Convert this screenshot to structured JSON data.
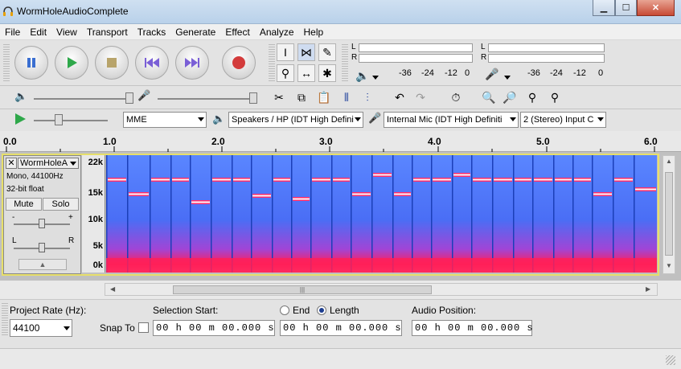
{
  "window": {
    "title": "WormHoleAudioComplete"
  },
  "menu": [
    "File",
    "Edit",
    "View",
    "Transport",
    "Tracks",
    "Generate",
    "Effect",
    "Analyze",
    "Help"
  ],
  "meters": {
    "left": "L",
    "right": "R",
    "ticks": [
      "-36",
      "-24",
      "-12",
      "0"
    ]
  },
  "device": {
    "host": "MME",
    "output": "Speakers / HP (IDT High Defini",
    "input": "Internal Mic (IDT High Definiti",
    "channels": "2 (Stereo) Input C"
  },
  "ruler": [
    "0.0",
    "1.0",
    "2.0",
    "3.0",
    "4.0",
    "5.0",
    "6.0"
  ],
  "track": {
    "name": "WormHoleA",
    "info1": "Mono, 44100Hz",
    "info2": "32-bit float",
    "mute": "Mute",
    "solo": "Solo",
    "gain_minus": "-",
    "gain_plus": "+",
    "pan_left": "L",
    "pan_right": "R",
    "yaxis": [
      "22k",
      "15k",
      "10k",
      "5k",
      "0k"
    ]
  },
  "bottom": {
    "project_rate_label": "Project Rate (Hz):",
    "project_rate": "44100",
    "selection_start_label": "Selection Start:",
    "snap_to": "Snap To",
    "end_label": "End",
    "length_label": "Length",
    "audio_position_label": "Audio Position:",
    "time_start": "00 h 00 m 00.000 s",
    "time_end": "00 h 00 m 00.000 s",
    "time_pos": "00 h 00 m 00.000 s"
  },
  "colors": {
    "spectrum_bg": "#3a6cff",
    "tone": "#ff2b6b",
    "accent": "#d94040"
  }
}
